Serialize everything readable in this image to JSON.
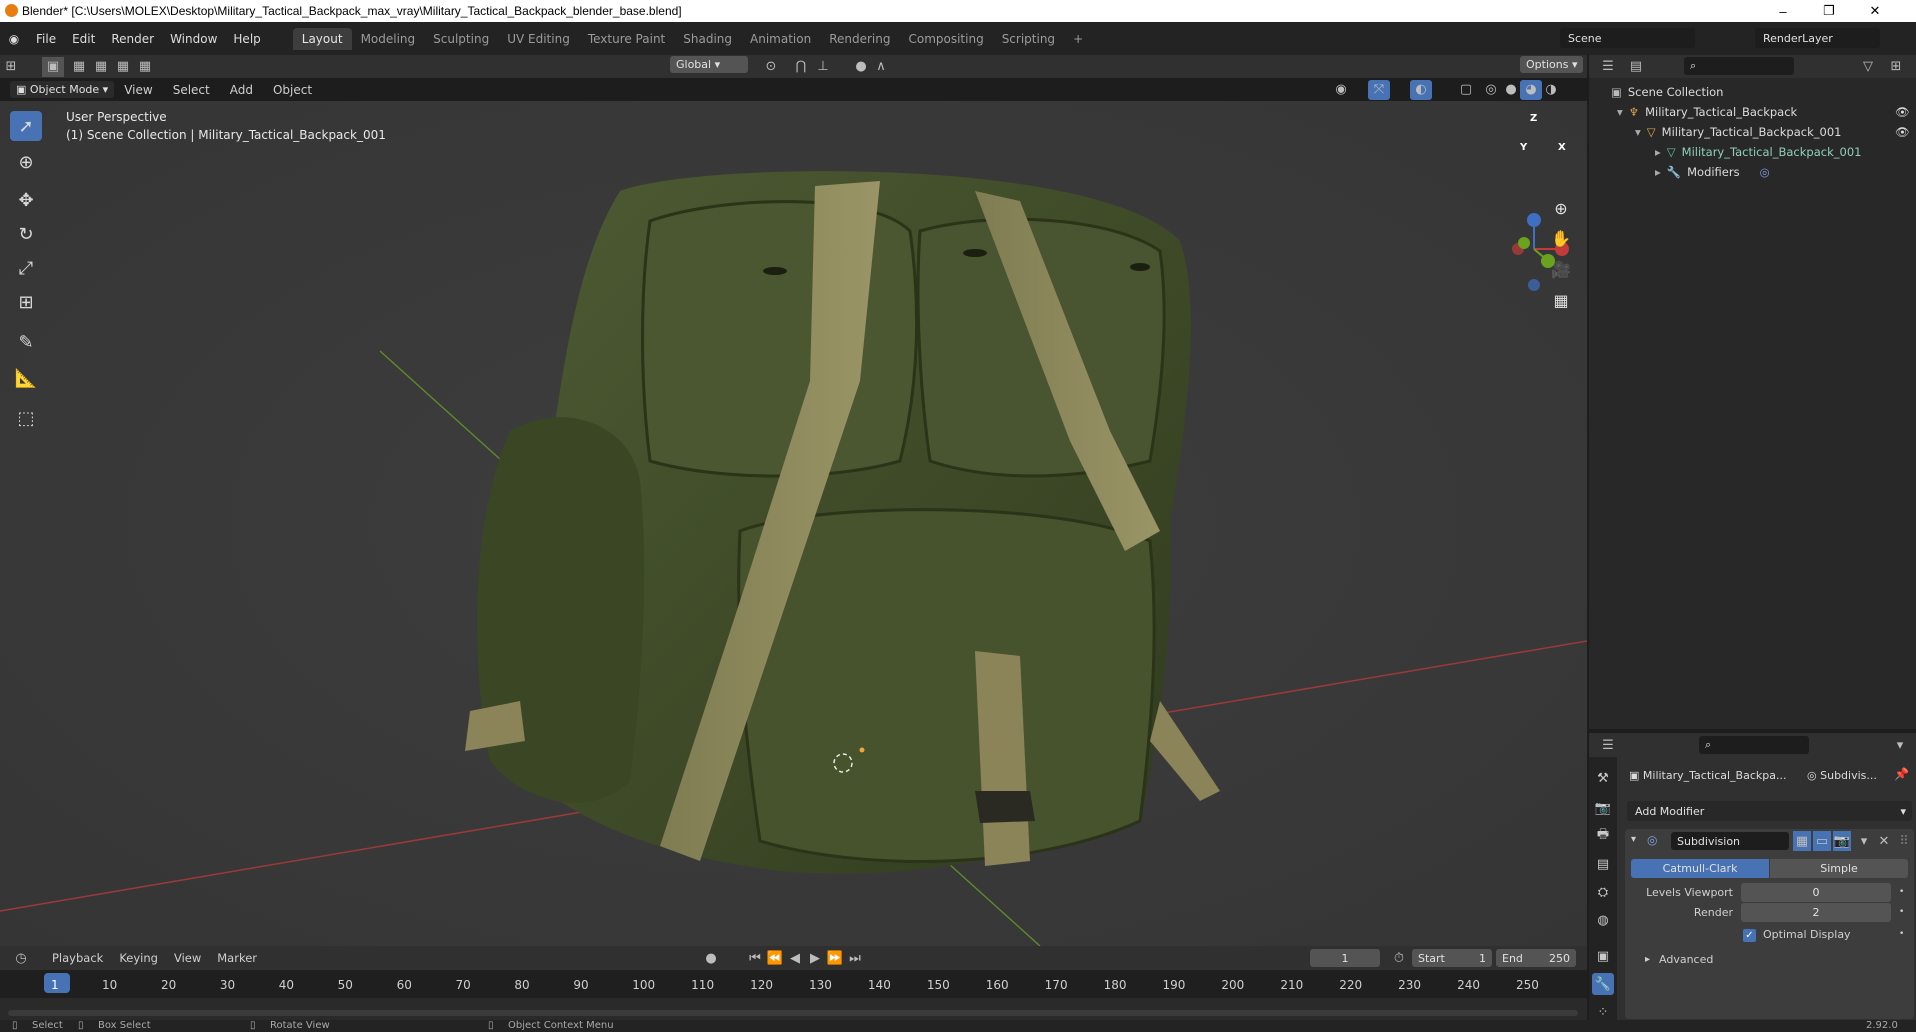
{
  "window": {
    "title": "Blender* [C:\\Users\\MOLEX\\Desktop\\Military_Tactical_Backpack_max_vray\\Military_Tactical_Backpack_blender_base.blend]",
    "minimize": "–",
    "restore": "❐",
    "close": "✕"
  },
  "menu": {
    "items": [
      "File",
      "Edit",
      "Render",
      "Window",
      "Help"
    ],
    "workspaces": [
      "Layout",
      "Modeling",
      "Sculpting",
      "UV Editing",
      "Texture Paint",
      "Shading",
      "Animation",
      "Rendering",
      "Compositing",
      "Scripting"
    ],
    "add_tab": "+",
    "scene": "Scene",
    "render_layer": "RenderLayer"
  },
  "header": {
    "transform_orientation": "Global",
    "options": "Options",
    "mode": "Object Mode",
    "menus": [
      "View",
      "Select",
      "Add",
      "Object"
    ]
  },
  "viewport": {
    "perspective": "User Perspective",
    "collection_info": "(1) Scene Collection | Military_Tactical_Backpack_001",
    "gizmo": {
      "z": "Z",
      "y": "Y",
      "x": "X"
    }
  },
  "outliner": {
    "root": "Scene Collection",
    "items": [
      "Military_Tactical_Backpack",
      "Military_Tactical_Backpack_001",
      "Military_Tactical_Backpack_001",
      "Modifiers"
    ]
  },
  "properties": {
    "object": "Military_Tactical_Backpa...",
    "modifier_short": "Subdivis...",
    "add_modifier": "Add Modifier",
    "modifier_name": "Subdivision",
    "catmull": "Catmull-Clark",
    "simple": "Simple",
    "levels_label": "Levels Viewport",
    "levels_value": "0",
    "render_label": "Render",
    "render_value": "2",
    "optimal": "Optimal Display",
    "advanced": "Advanced"
  },
  "timeline": {
    "menus": [
      "Playback",
      "Keying",
      "View",
      "Marker"
    ],
    "current_frame": "1",
    "start_label": "Start",
    "start": "1",
    "end_label": "End",
    "end": "250",
    "ticks": [
      "1",
      "10",
      "20",
      "30",
      "40",
      "50",
      "60",
      "70",
      "80",
      "90",
      "100",
      "110",
      "120",
      "130",
      "140",
      "150",
      "160",
      "170",
      "180",
      "190",
      "200",
      "210",
      "220",
      "230",
      "240",
      "250"
    ]
  },
  "status": {
    "select": "Select",
    "box_select": "Box Select",
    "rotate": "Rotate View",
    "context": "Object Context Menu",
    "version": "2.92.0"
  }
}
